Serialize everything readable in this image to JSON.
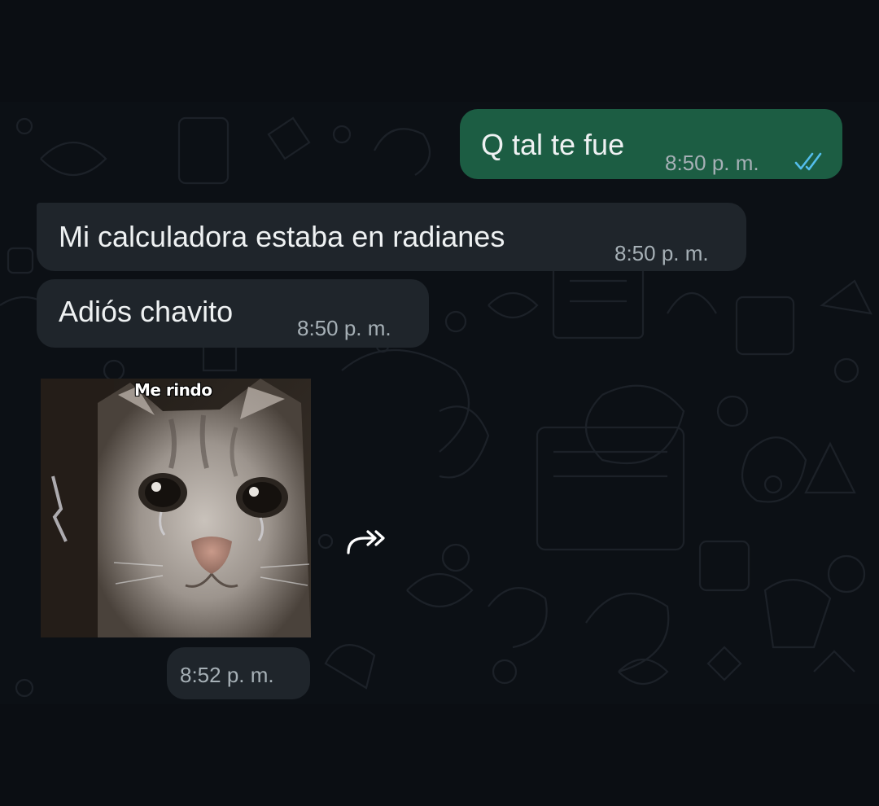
{
  "messages": [
    {
      "direction": "outgoing",
      "text": "Q tal te fue",
      "time": "8:50 p. m.",
      "status": "read"
    },
    {
      "direction": "incoming",
      "text": "Mi calculadora estaba en radianes",
      "time": "8:50 p. m."
    },
    {
      "direction": "incoming",
      "text": "Adiós chavito",
      "time": "8:50 p. m."
    }
  ],
  "sticker": {
    "caption": "Me rindo",
    "time": "8:52 p. m.",
    "forward_icon": "forward-icon"
  },
  "colors": {
    "background": "#0b0e13",
    "outgoing_bubble": "#1c5d43",
    "incoming_bubble": "#1f252b",
    "read_ticks": "#53bdeb"
  }
}
